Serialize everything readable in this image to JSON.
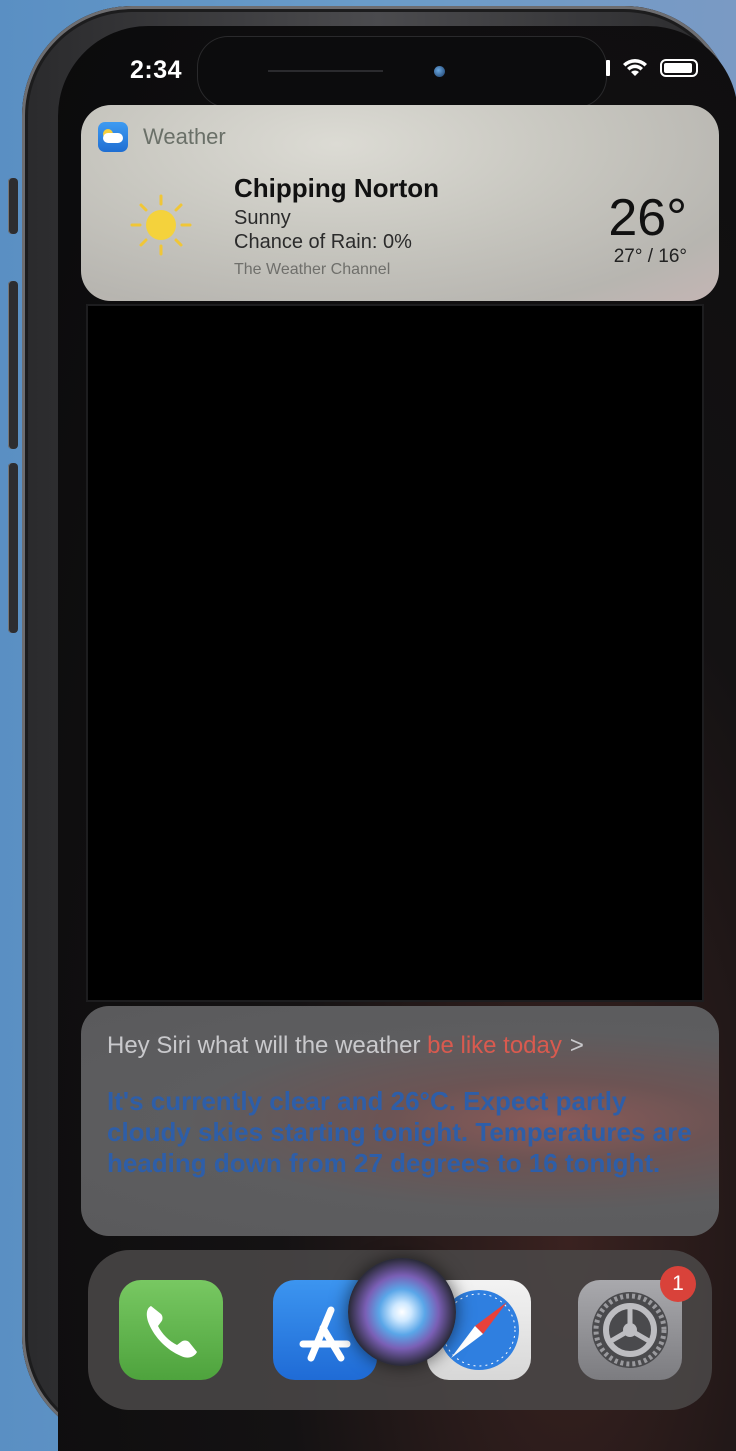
{
  "status_bar": {
    "time": "2:34"
  },
  "weather_widget": {
    "app_name": "Weather",
    "city": "Chipping Norton",
    "condition": "Sunny",
    "rain": "Chance of Rain: 0%",
    "source": "The Weather Channel",
    "temperature": "26°",
    "range": "27° / 16°"
  },
  "siri": {
    "query_part1": "Hey Siri what will the weather ",
    "query_part2": "be like today",
    "chevron": ">",
    "answer_part1": "It's currently clear and 26°C. Expect partly cloudy skies starting tonight. Temperatures are heading down from 27 degrees to 16 tonight."
  },
  "dock": {
    "apps": [
      "phone-icon",
      "app-store-icon",
      "safari-icon",
      "settings-icon"
    ],
    "settings_badge": "1"
  },
  "colors": {
    "query_highlight": "#d95a4f",
    "answer_text": "#2e5ea8",
    "badge": "#d9423a"
  }
}
